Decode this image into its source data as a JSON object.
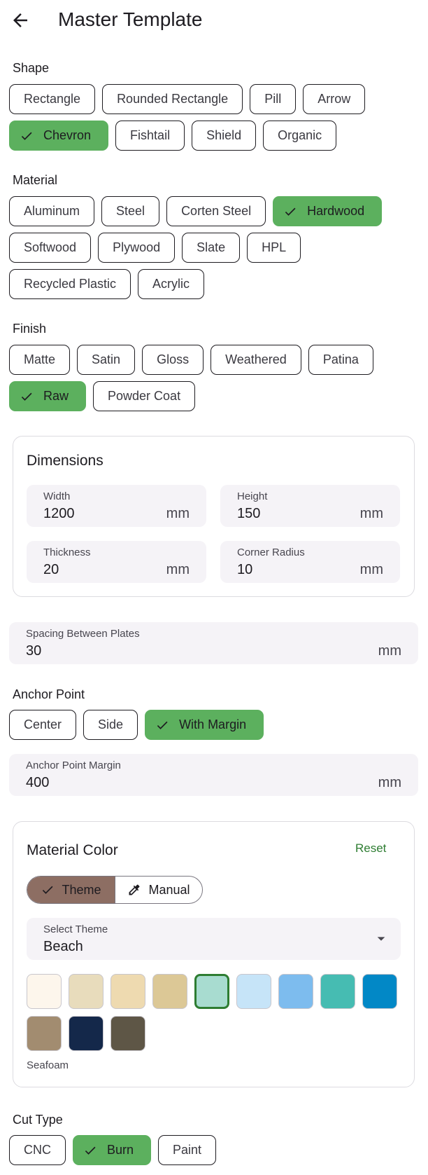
{
  "header": {
    "title": "Master Template"
  },
  "shape": {
    "label": "Shape",
    "row1": [
      "Rectangle",
      "Rounded Rectangle",
      "Pill",
      "Arrow"
    ],
    "row2": [
      "Chevron",
      "Fishtail",
      "Shield",
      "Organic"
    ],
    "selected": "Chevron"
  },
  "material": {
    "label": "Material",
    "row1": [
      "Aluminum",
      "Steel",
      "Corten Steel",
      "Hardwood"
    ],
    "row2": [
      "Softwood",
      "Plywood",
      "Slate",
      "HPL"
    ],
    "row3": [
      "Recycled Plastic",
      "Acrylic"
    ],
    "selected": "Hardwood"
  },
  "finish": {
    "label": "Finish",
    "row1": [
      "Matte",
      "Satin",
      "Gloss",
      "Weathered",
      "Patina"
    ],
    "row2": [
      "Raw",
      "Powder Coat"
    ],
    "selected": "Raw"
  },
  "dimensions": {
    "title": "Dimensions",
    "width": {
      "label": "Width",
      "value": "1200",
      "unit": "mm"
    },
    "height": {
      "label": "Height",
      "value": "150",
      "unit": "mm"
    },
    "thickness": {
      "label": "Thickness",
      "value": "20",
      "unit": "mm"
    },
    "corner_radius": {
      "label": "Corner Radius",
      "value": "10",
      "unit": "mm"
    }
  },
  "spacing": {
    "label": "Spacing Between Plates",
    "value": "30",
    "unit": "mm"
  },
  "anchor": {
    "label": "Anchor Point",
    "options": [
      "Center",
      "Side",
      "With Margin"
    ],
    "selected": "With Margin",
    "margin": {
      "label": "Anchor Point Margin",
      "value": "400",
      "unit": "mm"
    }
  },
  "material_color": {
    "title": "Material Color",
    "reset_label": "Reset",
    "mode": {
      "theme_label": "Theme",
      "manual_label": "Manual",
      "selected": "Theme"
    },
    "select_theme": {
      "label": "Select Theme",
      "value": "Beach"
    },
    "swatches_row1": [
      "#fdf6ec",
      "#e8dcbc",
      "#eedab0",
      "#dcc896",
      "#a8dcd0",
      "#c6e4f8",
      "#7dbcee",
      "#46bcb2",
      "#0288c6"
    ],
    "swatches_row2": [
      "#a28c70",
      "#14284a",
      "#5e5646"
    ],
    "selected_index": 4,
    "selected_name": "Seafoam"
  },
  "cut_type": {
    "label": "Cut Type",
    "options": [
      "CNC",
      "Burn",
      "Paint"
    ],
    "selected": "Burn"
  },
  "colors": {
    "accent_green": "#5cb05e",
    "reset_green": "#2e7d32",
    "theme_brown": "#8d6e63"
  }
}
